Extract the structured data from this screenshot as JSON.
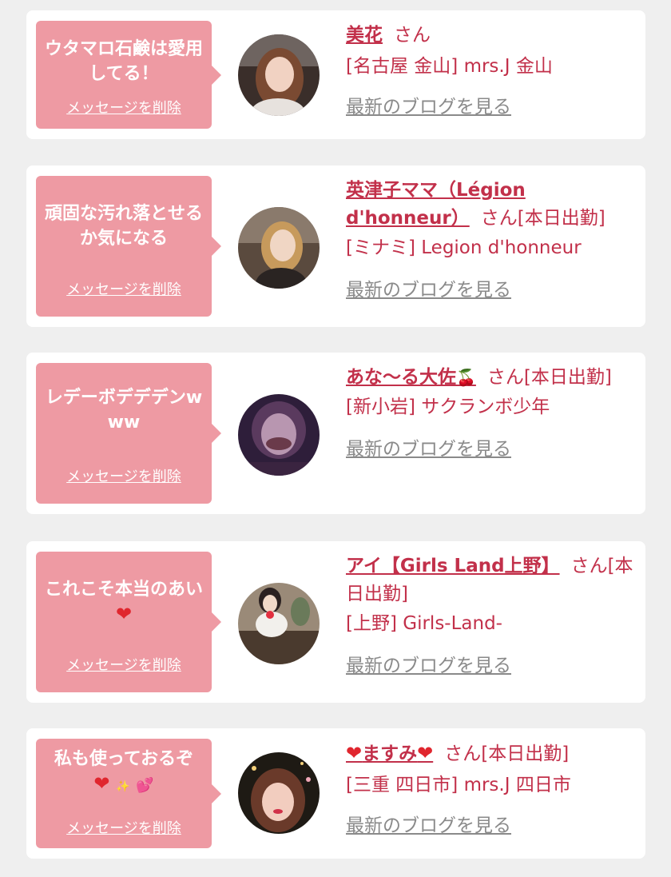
{
  "colors": {
    "page_bg": "#efefef",
    "card_bg": "#ffffff",
    "bubble_bg": "#ee9aa3",
    "accent": "#c2304a",
    "link_gray": "#8a8a8a"
  },
  "entries": [
    {
      "message": "ウタマロ石鹸は愛用してる！",
      "delete_label": "メッセージを削除",
      "name": "美花",
      "suffix": "さん",
      "location": "[名古屋 金山] mrs.J 金山",
      "blog_link": "最新のブログを見る",
      "avatar_icon": "woman-portrait-avatar"
    },
    {
      "message": "頑固な汚れ落とせるか気になる",
      "delete_label": "メッセージを削除",
      "name": "英津子ママ（Légion d'honneur）",
      "suffix": "さん[本日出勤]",
      "location": "[ミナミ] Legion d'honneur",
      "blog_link": "最新のブログを見る",
      "avatar_icon": "woman-portrait-avatar"
    },
    {
      "message": "レデーボデデデンwww",
      "delete_label": "メッセージを削除",
      "name": "あな〜る大佐",
      "name_icon": "🍒",
      "suffix": "さん[本日出勤]",
      "location": "[新小岩] サクランボ少年",
      "blog_link": "最新のブログを見る",
      "avatar_icon": "woman-portrait-avatar"
    },
    {
      "message_text": "これこそ本当のあい",
      "message_icon": "❤",
      "delete_label": "メッセージを削除",
      "name": "アイ【Girls Land上野】",
      "suffix": "さん[本日出勤]",
      "location": "[上野] Girls-Land-",
      "blog_link": "最新のブログを見る",
      "avatar_icon": "woman-portrait-avatar"
    },
    {
      "message_text": "私も使っておるぞ",
      "message_icons": [
        "❤",
        "✨",
        "💕"
      ],
      "delete_label": "メッセージを削除",
      "name_heart_left": "❤",
      "name": "ますみ",
      "name_heart_right": "❤",
      "suffix": "さん[本日出勤]",
      "location": "[三重 四日市] mrs.J 四日市",
      "blog_link": "最新のブログを見る",
      "avatar_icon": "woman-portrait-avatar"
    }
  ]
}
